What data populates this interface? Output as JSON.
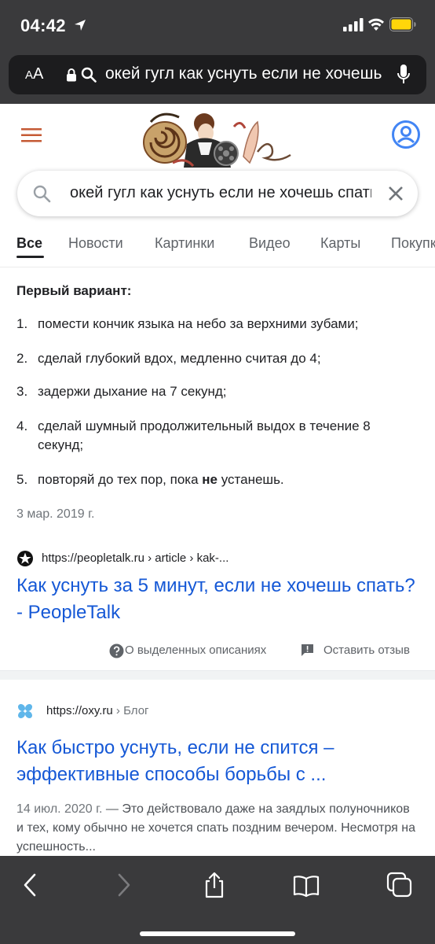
{
  "status_bar": {
    "time": "04:42"
  },
  "address_bar": {
    "text_size_label_small": "A",
    "text_size_label_large": "A",
    "url_text": "окей гугл как уснуть если не хочешь спать"
  },
  "search": {
    "query": "окей гугл как уснуть если не хочешь спать"
  },
  "tabs": [
    {
      "label": "Все",
      "active": true
    },
    {
      "label": "Новости"
    },
    {
      "label": "Картинки"
    },
    {
      "label": "Видео"
    },
    {
      "label": "Карты"
    },
    {
      "label": "Покупки"
    }
  ],
  "featured_snippet": {
    "heading": "Первый вариант:",
    "steps": [
      {
        "num": "1.",
        "text": "помести кончик языка на небо за верхними зубами;"
      },
      {
        "num": "2.",
        "text": "сделай глубокий вдох, медленно считая до 4;"
      },
      {
        "num": "3.",
        "text": "задержи дыхание на 7 секунд;"
      },
      {
        "num": "4.",
        "text": "сделай шумный продолжительный выдох в течение 8 секунд;"
      },
      {
        "num": "5.",
        "text_before": "повторяй до тех пор, пока ",
        "text_bold": "не",
        "text_after": " устанешь."
      }
    ],
    "date": "3 мар. 2019 г.",
    "source_url": "https://peopletalk.ru › article › kak-...",
    "title": "Как уснуть за 5 минут, если не хочешь спать? - PeopleTalk",
    "about_label": "О выделенных описаниях",
    "feedback_label": "Оставить отзыв"
  },
  "result2": {
    "site": "https://oxy.ru",
    "crumb": " › Блог",
    "title": "Как быстро уснуть, если не спится – эффективные способы борьбы с ...",
    "date": "14 июл. 2020 г.",
    "snippet": " — Это действовало даже на заядлых полуночников и тех, кому обычно не хочется спать поздним вечером. Несмотря на успешность..."
  },
  "colors": {
    "chrome_bg": "#3a3a3c",
    "link_blue": "#1558d6",
    "google_blue": "#4285f4",
    "menu_orange": "#c55a35"
  }
}
